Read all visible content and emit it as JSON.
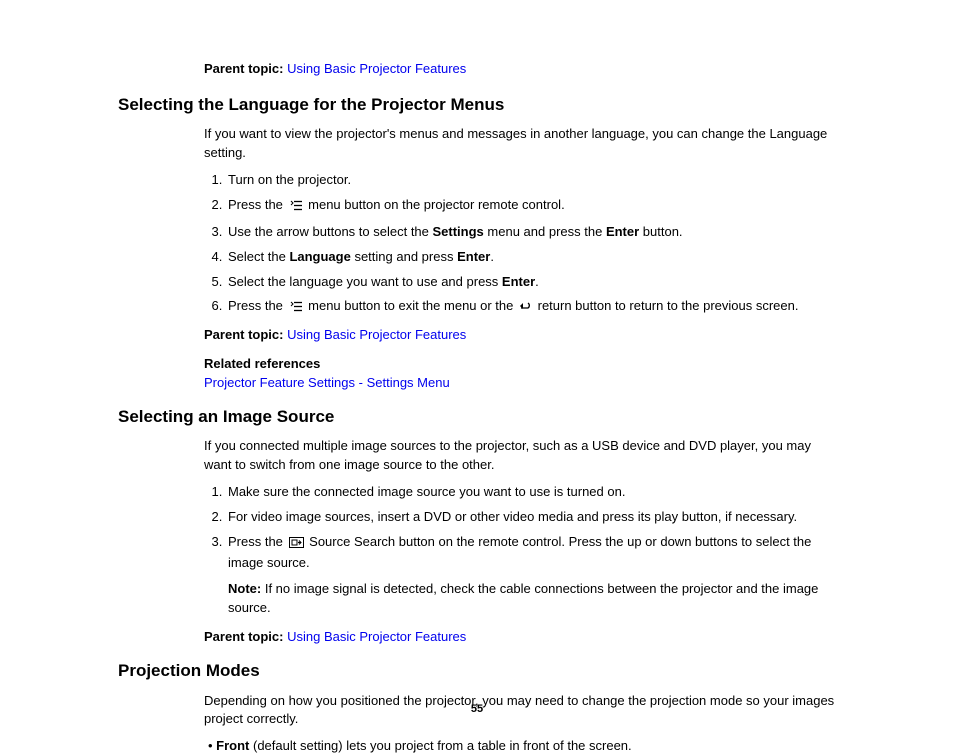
{
  "labels": {
    "parent_topic": "Parent topic:",
    "related_refs": "Related references",
    "note": "Note:"
  },
  "links": {
    "using_basic": "Using Basic Projector Features",
    "settings_menu": "Projector Feature Settings - Settings Menu"
  },
  "section1": {
    "heading": "Selecting the Language for the Projector Menus",
    "intro": "If you want to view the projector's menus and messages in another language, you can change the Language setting.",
    "step1": "Turn on the projector.",
    "step2_a": "Press the ",
    "step2_b": " menu button on the projector remote control.",
    "step3_a": "Use the arrow buttons to select the ",
    "step3_bold1": "Settings",
    "step3_b": " menu and press the ",
    "step3_bold2": "Enter",
    "step3_c": " button.",
    "step4_a": "Select the ",
    "step4_bold1": "Language",
    "step4_b": " setting and press ",
    "step4_bold2": "Enter",
    "step4_c": ".",
    "step5_a": "Select the language you want to use and press ",
    "step5_bold": "Enter",
    "step5_b": ".",
    "step6_a": "Press the ",
    "step6_b": " menu button to exit the menu or the ",
    "step6_c": " return button to return to the previous screen."
  },
  "section2": {
    "heading": "Selecting an Image Source",
    "intro": "If you connected multiple image sources to the projector, such as a USB device and DVD player, you may want to switch from one image source to the other.",
    "step1": "Make sure the connected image source you want to use is turned on.",
    "step2": "For video image sources, insert a DVD or other video media and press its play button, if necessary.",
    "step3_a": "Press the ",
    "step3_b": " Source Search button on the remote control. Press the up or down buttons to select the image source.",
    "note_text": " If no image signal is detected, check the cable connections between the projector and the image source."
  },
  "section3": {
    "heading": "Projection Modes",
    "intro": "Depending on how you positioned the projector, you may need to change the projection mode so your images project correctly.",
    "bullet1_bold": "Front",
    "bullet1_rest": " (default setting) lets you project from a table in front of the screen."
  },
  "page_number": "55"
}
